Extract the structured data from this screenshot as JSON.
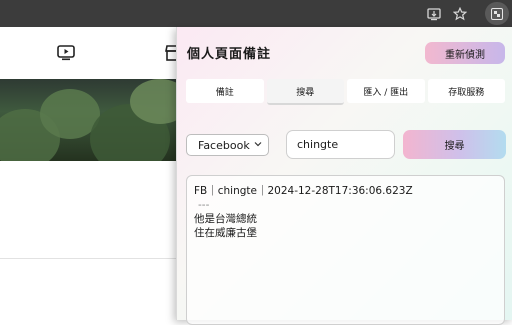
{
  "toolbar": {
    "icons": [
      "cast-install-icon",
      "star-bookmark-icon",
      "extension-icon"
    ]
  },
  "background_page": {
    "nav_icons": [
      "video-icon",
      "store-icon"
    ]
  },
  "popup": {
    "title": "個人頁面備註",
    "redetect_label": "重新偵測",
    "tabs": [
      {
        "label": "備註",
        "active": false
      },
      {
        "label": "搜尋",
        "active": true
      },
      {
        "label": "匯入 / 匯出",
        "active": false
      },
      {
        "label": "存取服務",
        "active": false
      }
    ],
    "search": {
      "platform": "Facebook",
      "query": "chingte",
      "button_label": "搜尋"
    },
    "result": {
      "header": "FB｜chingte｜2024-12-28T17:36:06.623Z",
      "separator": "---",
      "lines": [
        "他是台灣總統",
        "住在威廉古堡"
      ]
    }
  }
}
